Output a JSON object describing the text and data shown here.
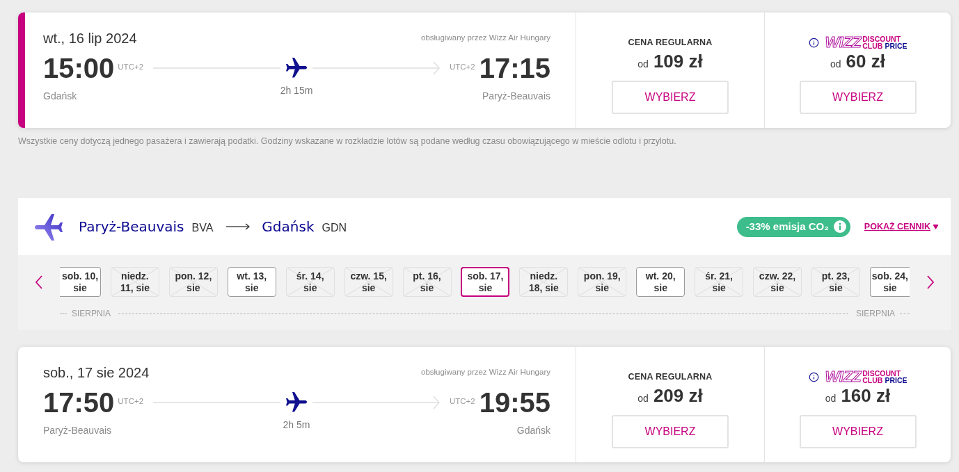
{
  "outbound_flight": {
    "selected": true,
    "date": "wt., 16 lip 2024",
    "operator": "obsługiwany przez Wizz Air Hungary",
    "departure": {
      "time": "15:00",
      "timezone": "UTC+2",
      "city": "Gdańsk"
    },
    "arrival": {
      "time": "17:15",
      "timezone": "UTC+2",
      "city": "Paryż-Beauvais"
    },
    "duration": "2h 15m",
    "fares": [
      {
        "kind": "regular",
        "label": "CENA REGULARNA",
        "prefix": "od",
        "price": "109 zł",
        "button": "WYBIERZ"
      },
      {
        "kind": "club",
        "logo": {
          "wordmark": "WIZZ",
          "line_1": "DISCOUNT",
          "line_2": "CLUB",
          "line_2_accent": "PRICE"
        },
        "prefix": "od",
        "price": "60 zł",
        "button": "WYBIERZ"
      }
    ]
  },
  "footnote": "Wszystkie ceny dotyczą jednego pasażera i zawierają podatki. Godziny wskazane w rozkładzie lotów są podane według czasu obowiązującego w mieście odlotu i przylotu.",
  "return_route": {
    "origin": {
      "city": "Paryż-Beauvais",
      "code": "BVA"
    },
    "destination": {
      "city": "Gdańsk",
      "code": "GDN"
    },
    "co2_badge": "-33% emisja CO₂",
    "price_list_link": "POKAŻ CENNIK"
  },
  "date_strip": {
    "dates": [
      {
        "line_1": "sob. 10,",
        "line_2": "sie",
        "available": true,
        "selected": false
      },
      {
        "line_1": "niedz.",
        "line_2": "11, sie",
        "available": false,
        "selected": false
      },
      {
        "line_1": "pon. 12,",
        "line_2": "sie",
        "available": false,
        "selected": false
      },
      {
        "line_1": "wt. 13,",
        "line_2": "sie",
        "available": true,
        "selected": false
      },
      {
        "line_1": "śr. 14,",
        "line_2": "sie",
        "available": false,
        "selected": false
      },
      {
        "line_1": "czw. 15,",
        "line_2": "sie",
        "available": false,
        "selected": false
      },
      {
        "line_1": "pt. 16,",
        "line_2": "sie",
        "available": false,
        "selected": false
      },
      {
        "line_1": "sob. 17,",
        "line_2": "sie",
        "available": true,
        "selected": true
      },
      {
        "line_1": "niedz.",
        "line_2": "18, sie",
        "available": false,
        "selected": false
      },
      {
        "line_1": "pon. 19,",
        "line_2": "sie",
        "available": false,
        "selected": false
      },
      {
        "line_1": "wt. 20,",
        "line_2": "sie",
        "available": true,
        "selected": false
      },
      {
        "line_1": "śr. 21,",
        "line_2": "sie",
        "available": false,
        "selected": false
      },
      {
        "line_1": "czw. 22,",
        "line_2": "sie",
        "available": false,
        "selected": false
      },
      {
        "line_1": "pt. 23,",
        "line_2": "sie",
        "available": false,
        "selected": false
      },
      {
        "line_1": "sob. 24,",
        "line_2": "sie",
        "available": true,
        "selected": false
      }
    ],
    "month_labels": [
      "SIERPNIA",
      "SIERPNIA"
    ]
  },
  "return_flight": {
    "selected": false,
    "date": "sob., 17 sie 2024",
    "operator": "obsługiwany przez Wizz Air Hungary",
    "departure": {
      "time": "17:50",
      "timezone": "UTC+2",
      "city": "Paryż-Beauvais"
    },
    "arrival": {
      "time": "19:55",
      "timezone": "UTC+2",
      "city": "Gdańsk"
    },
    "duration": "2h 5m",
    "fares": [
      {
        "kind": "regular",
        "label": "CENA REGULARNA",
        "prefix": "od",
        "price": "209 zł",
        "button": "WYBIERZ"
      },
      {
        "kind": "club",
        "logo": {
          "wordmark": "WIZZ",
          "line_1": "DISCOUNT",
          "line_2": "CLUB",
          "line_2_accent": "PRICE"
        },
        "prefix": "od",
        "price": "160 zł",
        "button": "WYBIERZ"
      }
    ]
  }
}
